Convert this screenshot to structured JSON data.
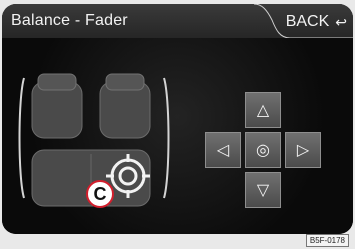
{
  "header": {
    "title": "Balance - Fader",
    "back_label": "BACK"
  },
  "dpad": {
    "up": "up-arrow",
    "left": "left-arrow",
    "center": "center-target",
    "right": "right-arrow",
    "down": "down-arrow"
  },
  "callout_letter": "C",
  "image_code": "B5F-0178",
  "colors": {
    "screen_bg": "#050505",
    "header_bg": "#2d2d2d",
    "callout_red": "#d21e2c"
  }
}
